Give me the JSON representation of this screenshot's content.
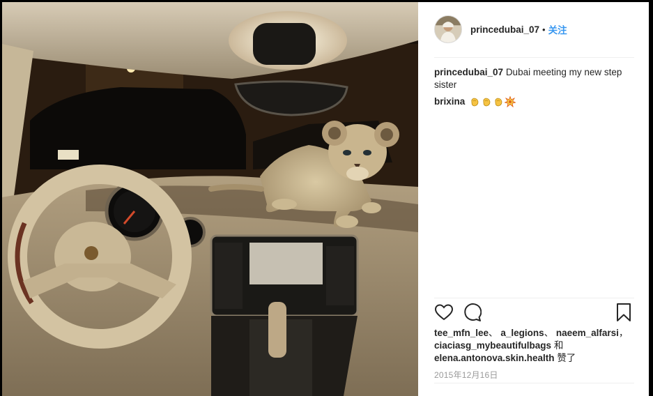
{
  "post": {
    "username": "princedubai_07",
    "separator": "•",
    "follow_label": "关注",
    "caption_text": "Dubai meeting my new step sister",
    "comments": [
      {
        "username": "brixina",
        "emoji": [
          "clapping-hands",
          "clapping-hands",
          "clapping-hands",
          "collision"
        ]
      }
    ],
    "likes": {
      "users": [
        "tee_mfn_lee",
        "a_legions",
        "naeem_alfarsi",
        "ciaciasg_mybeautifulbags",
        "elena.antonova.skin.health"
      ],
      "sep_1": "、",
      "sep_2": "、",
      "sep_3": "，",
      "conjunction": "和",
      "suffix": "赞了"
    },
    "date": "2015年12月16日"
  },
  "icons": {
    "like": "heart-icon",
    "comment": "comment-icon",
    "save": "bookmark-icon"
  },
  "colors": {
    "link_blue": "#3897f0",
    "text": "#262626",
    "muted": "#999999"
  }
}
